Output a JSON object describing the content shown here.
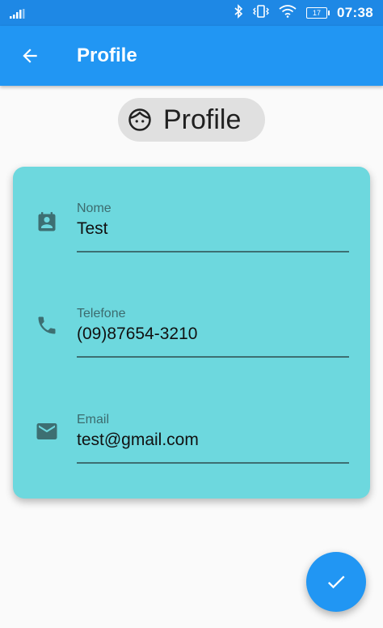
{
  "status_bar": {
    "time": "07:38",
    "battery_level": "17",
    "icons": [
      "signal-icon",
      "bluetooth-icon",
      "vibrate-icon",
      "wifi-icon",
      "battery-icon"
    ]
  },
  "app_bar": {
    "title": "Profile",
    "back_icon": "arrow-back-icon",
    "color": "#2196f3"
  },
  "chip": {
    "label": "Profile",
    "icon": "face-icon"
  },
  "form": {
    "card_color": "#6dd8de",
    "fields": [
      {
        "label": "Nome",
        "value": "Test",
        "icon": "contact-calendar-icon"
      },
      {
        "label": "Telefone",
        "value": "(09)87654-3210",
        "icon": "phone-icon"
      },
      {
        "label": "Email",
        "value": "test@gmail.com",
        "icon": "email-icon"
      }
    ]
  },
  "fab": {
    "icon": "check-icon",
    "color": "#2196f3"
  }
}
